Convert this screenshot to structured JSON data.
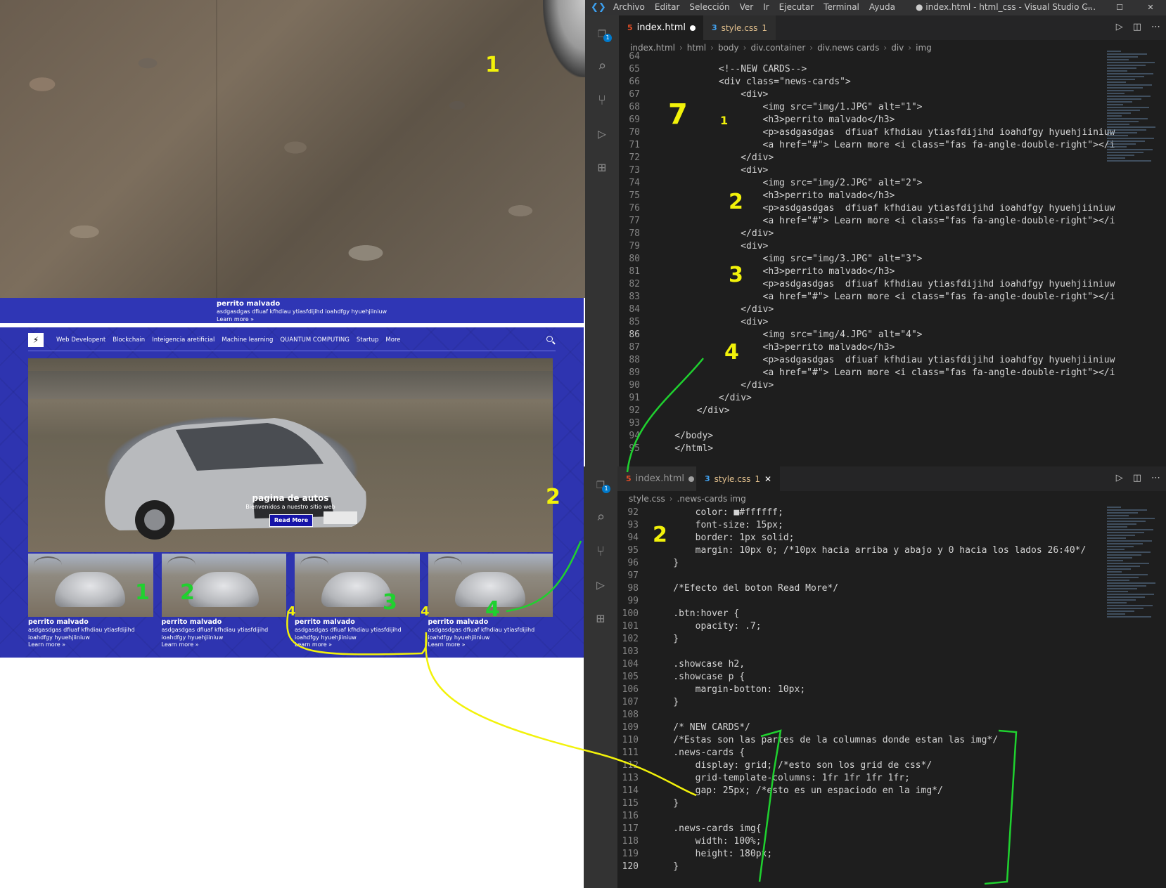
{
  "preview": {
    "strip": {
      "title": "perrito malvado",
      "text": "asdgasdgas dfiuaf kfhdiau ytiasfdijihd ioahdfgy hyuehjiiniuw",
      "link": "Learn more »"
    },
    "nav": {
      "logo": "⚡",
      "items": [
        "Web Developent",
        "Blockchain",
        "Inteigencia aretificial",
        "Machine learning",
        "QUANTUM COMPUTING",
        "Startup",
        "More"
      ],
      "search_icon": "search-icon"
    },
    "hero": {
      "title": "pagina de autos",
      "subtitle": "Bienvenidos a nuestro sitio web",
      "button": "Read More"
    },
    "cards": [
      {
        "title": "perrito malvado",
        "text": "asdgasdgas dfiuaf kfhdiau ytiasfdijihd ioahdfgy hyuehjiiniuw",
        "link": "Learn more »"
      },
      {
        "title": "perrito malvado",
        "text": "asdgasdgas dfiuaf kfhdiau ytiasfdijihd ioahdfgy hyuehjiiniuw",
        "link": "Learn more »"
      },
      {
        "title": "perrito malvado",
        "text": "asdgasdgas dfiuaf kfhdiau ytiasfdijihd ioahdfgy hyuehjiiniuw",
        "link": "Learn more »"
      },
      {
        "title": "perrito malvado",
        "text": "asdgasdgas dfiuaf kfhdiau ytiasfdijihd ioahdfgy hyuehjiiniuw",
        "link": "Learn more »"
      }
    ]
  },
  "vscode_top": {
    "menu": [
      "Archivo",
      "Editar",
      "Selección",
      "Ver",
      "Ir",
      "Ejecutar",
      "Terminal",
      "Ayuda"
    ],
    "window_title": "● index.html - html_css - Visual Studio C...",
    "window_controls": [
      "—",
      "☐",
      "✕"
    ],
    "tabs": [
      {
        "label": "index.html",
        "icon": "html-file-icon",
        "state": "active-modified"
      },
      {
        "label": "style.css",
        "icon": "css-file-icon",
        "problems": "1"
      }
    ],
    "breadcrumb": [
      "index.html",
      "html",
      "body",
      "div.container",
      "div.news cards",
      "div",
      "img"
    ],
    "activity_badge": "1",
    "current_line": "86",
    "lines": [
      {
        "n": "64",
        "t": ""
      },
      {
        "n": "65",
        "t": "            <!--NEW CARDS-->"
      },
      {
        "n": "66",
        "t": "            <div class=\"news-cards\">"
      },
      {
        "n": "67",
        "t": "                <div>"
      },
      {
        "n": "68",
        "t": "                    <img src=\"img/1.JPG\" alt=\"1\">"
      },
      {
        "n": "69",
        "t": "                    <h3>perrito malvado</h3>"
      },
      {
        "n": "70",
        "t": "                    <p>asdgasdgas  dfiuaf kfhdiau ytiasfdijihd ioahdfgy hyuehjiiniuw"
      },
      {
        "n": "71",
        "t": "                    <a href=\"#\"> Learn more <i class=\"fas fa-angle-double-right\"></i"
      },
      {
        "n": "72",
        "t": "                </div>"
      },
      {
        "n": "73",
        "t": "                <div>"
      },
      {
        "n": "74",
        "t": "                    <img src=\"img/2.JPG\" alt=\"2\">"
      },
      {
        "n": "75",
        "t": "                    <h3>perrito malvado</h3>"
      },
      {
        "n": "76",
        "t": "                    <p>asdgasdgas  dfiuaf kfhdiau ytiasfdijihd ioahdfgy hyuehjiiniuw"
      },
      {
        "n": "77",
        "t": "                    <a href=\"#\"> Learn more <i class=\"fas fa-angle-double-right\"></i"
      },
      {
        "n": "78",
        "t": "                </div>"
      },
      {
        "n": "79",
        "t": "                <div>"
      },
      {
        "n": "80",
        "t": "                    <img src=\"img/3.JPG\" alt=\"3\">"
      },
      {
        "n": "81",
        "t": "                    <h3>perrito malvado</h3>"
      },
      {
        "n": "82",
        "t": "                    <p>asdgasdgas  dfiuaf kfhdiau ytiasfdijihd ioahdfgy hyuehjiiniuw"
      },
      {
        "n": "83",
        "t": "                    <a href=\"#\"> Learn more <i class=\"fas fa-angle-double-right\"></i"
      },
      {
        "n": "84",
        "t": "                </div>"
      },
      {
        "n": "85",
        "t": "                <div>"
      },
      {
        "n": "86",
        "t": "                    <img src=\"img/4.JPG\" alt=\"4\">"
      },
      {
        "n": "87",
        "t": "                    <h3>perrito malvado</h3>"
      },
      {
        "n": "88",
        "t": "                    <p>asdgasdgas  dfiuaf kfhdiau ytiasfdijihd ioahdfgy hyuehjiiniuw"
      },
      {
        "n": "89",
        "t": "                    <a href=\"#\"> Learn more <i class=\"fas fa-angle-double-right\"></i"
      },
      {
        "n": "90",
        "t": "                </div>"
      },
      {
        "n": "91",
        "t": "            </div>"
      },
      {
        "n": "92",
        "t": "        </div>"
      },
      {
        "n": "93",
        "t": ""
      },
      {
        "n": "94",
        "t": "    </body>"
      },
      {
        "n": "95",
        "t": "    </html>"
      }
    ]
  },
  "vscode_bottom": {
    "tabs": [
      {
        "label": "index.html",
        "icon": "html-file-icon",
        "state": "inactive-modified"
      },
      {
        "label": "style.css",
        "icon": "css-file-icon",
        "problems": "1",
        "close": "✕"
      }
    ],
    "breadcrumb": [
      "style.css",
      ".news-cards img"
    ],
    "activity_badge": "1",
    "current_line": "120",
    "lines": [
      {
        "n": "92",
        "t": "        color: ■#ffffff;"
      },
      {
        "n": "93",
        "t": "        font-size: 15px;"
      },
      {
        "n": "94",
        "t": "        border: 1px solid;"
      },
      {
        "n": "95",
        "t": "        margin: 10px 0; /*10px hacia arriba y abajo y 0 hacia los lados 26:40*/"
      },
      {
        "n": "96",
        "t": "    }"
      },
      {
        "n": "97",
        "t": ""
      },
      {
        "n": "98",
        "t": "    /*Efecto del boton Read More*/"
      },
      {
        "n": "99",
        "t": ""
      },
      {
        "n": "100",
        "t": "    .btn:hover {"
      },
      {
        "n": "101",
        "t": "        opacity: .7;"
      },
      {
        "n": "102",
        "t": "    }"
      },
      {
        "n": "103",
        "t": ""
      },
      {
        "n": "104",
        "t": "    .showcase h2,"
      },
      {
        "n": "105",
        "t": "    .showcase p {"
      },
      {
        "n": "106",
        "t": "        margin-botton: 10px;"
      },
      {
        "n": "107",
        "t": "    }"
      },
      {
        "n": "108",
        "t": ""
      },
      {
        "n": "109",
        "t": "    /* NEW CARDS*/"
      },
      {
        "n": "110",
        "t": "    /*Estas son las partes de la columnas donde estan las img*/"
      },
      {
        "n": "111",
        "t": "    .news-cards {"
      },
      {
        "n": "112",
        "t": "        display: grid; /*esto son los grid de css*/"
      },
      {
        "n": "113",
        "t": "        grid-template-columns: 1fr 1fr 1fr 1fr;"
      },
      {
        "n": "114",
        "t": "        gap: 25px; /*esto es un espaciodo en la img*/"
      },
      {
        "n": "115",
        "t": "    }"
      },
      {
        "n": "116",
        "t": ""
      },
      {
        "n": "117",
        "t": "    .news-cards img{"
      },
      {
        "n": "118",
        "t": "        width: 100%;"
      },
      {
        "n": "119",
        "t": "        height: 180px;"
      },
      {
        "n": "120",
        "t": "    }"
      }
    ]
  },
  "annotations": {
    "left_1": "1",
    "left_2": "2",
    "card_1": "1",
    "card_2": "2",
    "card_3": "3",
    "card_4": "4",
    "gap_a": "4",
    "gap_b": "4",
    "code_7": "7",
    "code_1": "1",
    "code_2": "2",
    "code_3": "3",
    "code_4": "4",
    "css_2": "2"
  },
  "colors": {
    "site_bg": "#2e34b0",
    "editor_bg": "#1e1e1e",
    "annot_yellow": "#f2f20a",
    "annot_green": "#1fd12f"
  }
}
